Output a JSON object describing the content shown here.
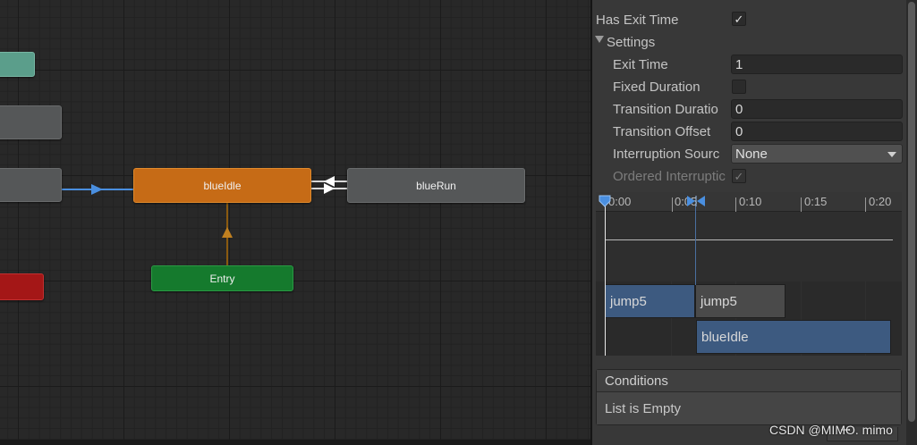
{
  "graph": {
    "nodes": {
      "blue_idle": "blueIdle",
      "blue_run": "blueRun",
      "entry": "Entry"
    },
    "colors": {
      "default_state": "#c66b16",
      "state": "#555758",
      "entry": "#157a2d",
      "any_state": "#5b9e8b",
      "exit": "#a41717",
      "transition_selected": "#4a8fe0"
    }
  },
  "inspector": {
    "has_exit_time": {
      "label": "Has Exit Time",
      "checked": "✓"
    },
    "settings": {
      "label": "Settings",
      "expand_icon": "triangle-down-icon"
    },
    "exit_time": {
      "label": "Exit Time",
      "value": "1"
    },
    "fixed_duration": {
      "label": "Fixed Duration"
    },
    "transition_duration": {
      "label": "Transition Duratio",
      "value": "0"
    },
    "transition_offset": {
      "label": "Transition Offset",
      "value": "0"
    },
    "interruption_source": {
      "label": "Interruption Sourc",
      "value": "None"
    },
    "ordered_interruption": {
      "label": "Ordered Interruptic",
      "checked": "✓"
    },
    "timeline": {
      "ticks": [
        "0:00",
        "0:05",
        "0:10",
        "0:15",
        "0:20"
      ],
      "clips": {
        "source_a": "jump5",
        "source_b": "jump5",
        "destination": "blueIdle"
      }
    },
    "conditions": {
      "header": "Conditions",
      "empty_text": "List is Empty"
    }
  },
  "watermark": "CSDN @MIMO. mimo"
}
